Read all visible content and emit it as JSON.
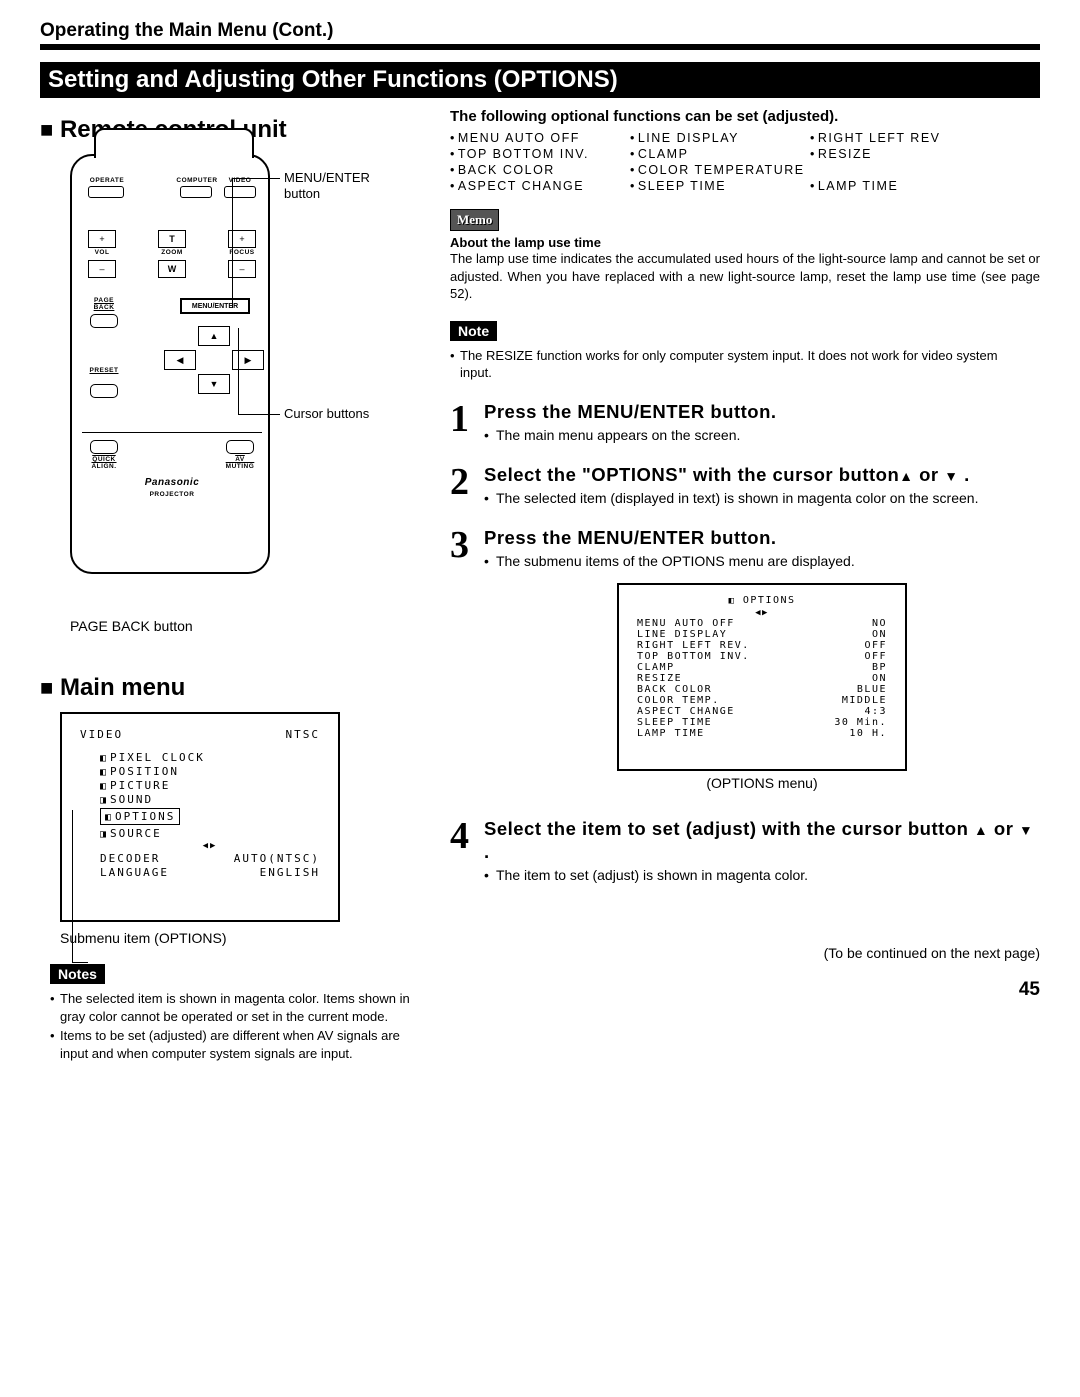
{
  "header": "Operating the Main Menu (Cont.)",
  "band": "Setting and Adjusting Other Functions (OPTIONS)",
  "left": {
    "remote_heading": "Remote control unit",
    "callouts": {
      "menu_enter": "MENU/ENTER button",
      "cursor": "Cursor buttons",
      "page_back": "PAGE BACK button"
    },
    "remote_labels": {
      "operate": "OPERATE",
      "computer": "COMPUTER",
      "video": "VIDEO",
      "vol": "VOL",
      "zoom": "ZOOM",
      "focus": "FOCUS",
      "menu_enter": "MENU/ENTER",
      "page_back": "PAGE BACK",
      "preset": "PRESET",
      "quick_align": "QUICK ALIGN.",
      "av_muting": "AV MUTING",
      "brand": "Panasonic",
      "projector": "PROJECTOR",
      "t": "T",
      "w": "W",
      "plus": "+",
      "minus": "–"
    },
    "main_menu_heading": "Main menu",
    "main_menu": {
      "input": "VIDEO",
      "system": "NTSC",
      "items": [
        "PIXEL CLOCK",
        "POSITION",
        "PICTURE",
        "SOUND",
        "OPTIONS",
        "SOURCE"
      ],
      "decoder_l": "DECODER",
      "decoder_v": "AUTO(NTSC)",
      "lang_l": "LANGUAGE",
      "lang_v": "ENGLISH"
    },
    "submenu_caption": "Submenu item (OPTIONS)",
    "notes_label": "Notes",
    "notes": [
      "The selected item is shown in magenta color. Items shown in gray color cannot be operated or set in the current mode.",
      "Items to be set (adjusted) are different when AV signals are input and when computer system signals are input."
    ]
  },
  "right": {
    "intro": "The following optional functions can be set (adjusted).",
    "funcs": [
      "MENU AUTO OFF",
      "LINE DISPLAY",
      "RIGHT LEFT REV",
      "TOP BOTTOM INV.",
      "CLAMP",
      "RESIZE",
      "BACK COLOR",
      "COLOR TEMPERATURE",
      "",
      "ASPECT CHANGE",
      "SLEEP TIME",
      "LAMP TIME"
    ],
    "memo_label": "Memo",
    "memo_title": "About the lamp use time",
    "memo_body": "The lamp use time indicates the accumulated used hours of the light-source lamp and cannot be set or adjusted. When you have replaced with a new light-source lamp, reset the lamp use time (see page 52).",
    "note_label": "Note",
    "note_items": [
      "The RESIZE function works for only computer system input. It does not work for video system input."
    ],
    "steps": {
      "s1_title": "Press  the  MENU/ENTER  button.",
      "s1_b1": "The main menu appears on the screen.",
      "s2_title_a": "Select  the  \"OPTIONS\"  with  the  cursor button",
      "s2_title_b": " or ",
      "s2_title_c": " .",
      "s2_b1": "The selected item (displayed in text) is shown in magenta color on the screen.",
      "s3_title": "Press  the  MENU/ENTER  button.",
      "s3_b1": "The submenu items of the OPTIONS menu are displayed.",
      "s4_title_a": "Select  the  item  to  set  (adjust)  with  the cursor button ",
      "s4_title_b": " or ",
      "s4_title_c": " .",
      "s4_b1": "The item to set (adjust) is shown in magenta color."
    },
    "options_box": {
      "title": "OPTIONS",
      "rows": [
        [
          "MENU AUTO OFF",
          "NO"
        ],
        [
          "LINE DISPLAY",
          "ON"
        ],
        [
          "RIGHT LEFT REV.",
          "OFF"
        ],
        [
          "TOP BOTTOM INV.",
          "OFF"
        ],
        [
          "CLAMP",
          "BP"
        ],
        [
          "RESIZE",
          "ON"
        ],
        [
          "BACK COLOR",
          "BLUE"
        ],
        [
          "COLOR TEMP.",
          "MIDDLE"
        ],
        [
          "ASPECT CHANGE",
          "4:3"
        ],
        [
          "SLEEP TIME",
          "30  Min."
        ],
        [
          "LAMP TIME",
          "10  H."
        ]
      ],
      "caption": "(OPTIONS menu)"
    },
    "continued": "(To be continued on the next page)"
  },
  "page_number": "45"
}
